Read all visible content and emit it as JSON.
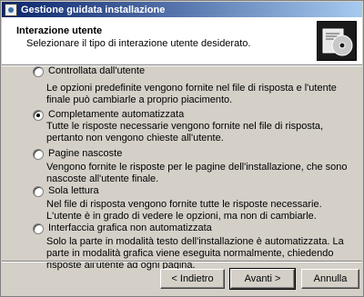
{
  "window": {
    "title": "Gestione guidata installazione"
  },
  "header": {
    "title": "Interazione utente",
    "subtitle": "Selezionare il tipo di interazione utente desiderato."
  },
  "options": [
    {
      "label": "Controllata dall'utente",
      "checked": false,
      "description": "Le opzioni predefinite vengono fornite nel file di risposta e l'utente finale può cambiarle a proprio piacimento."
    },
    {
      "label": "Completamente automatizzata",
      "checked": true,
      "description": "Tutte le risposte necessarie vengono fornite nel file di risposta, pertanto non vengono chieste all'utente."
    },
    {
      "label": "Pagine nascoste",
      "checked": false,
      "description": "Vengono fornite le risposte per le pagine dell'installazione, che sono nascoste all'utente finale."
    },
    {
      "label": "Sola lettura",
      "checked": false,
      "description": "Nel file di risposta vengono fornite tutte le risposte necessarie. L'utente è in grado di vedere le opzioni, ma non di cambiarle."
    },
    {
      "label": "Interfaccia grafica non automatizzata",
      "checked": false,
      "description": "Solo la parte in modalità testo dell'installazione è automatizzata. La parte in modalità grafica viene eseguita normalmente, chiedendo risposte all'utente ad ogni pagina."
    }
  ],
  "buttons": {
    "back": "< Indietro",
    "next": "Avanti >",
    "cancel": "Annulla"
  }
}
